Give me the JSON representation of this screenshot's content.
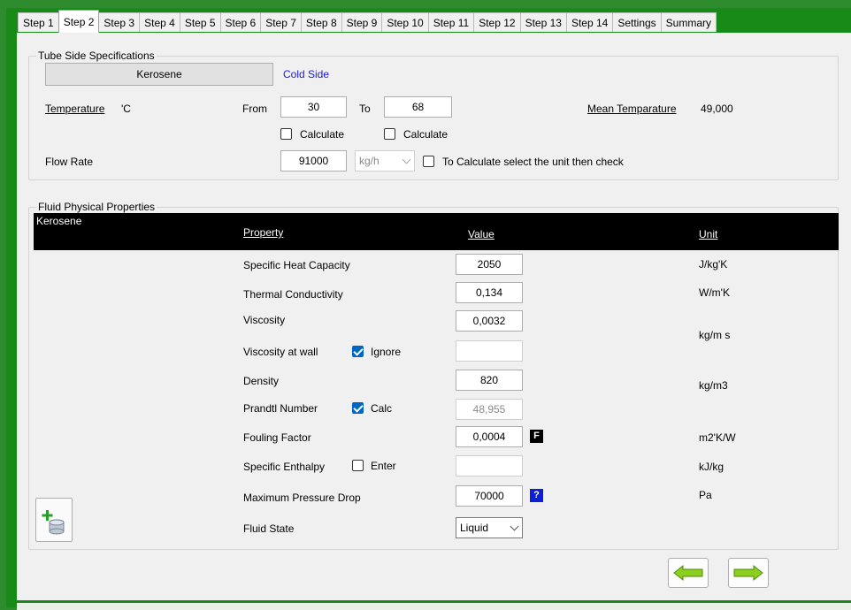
{
  "tabs": [
    "Step 1",
    "Step 2",
    "Step 3",
    "Step 4",
    "Step 5",
    "Step 6",
    "Step 7",
    "Step 8",
    "Step 9",
    "Step 10",
    "Step 11",
    "Step 12",
    "Step 13",
    "Step 14",
    "Settings",
    "Summary"
  ],
  "active_tab": "Step 2",
  "tube_side": {
    "legend": "Tube Side Specifications",
    "fluid_button": "Kerosene",
    "side_label": "Cold Side",
    "temperature_label": "Temperature",
    "temperature_unit": "'C",
    "from_label": "From",
    "from_value": "30",
    "to_label": "To",
    "to_value": "68",
    "calculate_from_label": "Calculate",
    "calculate_to_label": "Calculate",
    "mean_label": "Mean Temparature",
    "mean_value": "49,000",
    "flow_label": "Flow Rate",
    "flow_value": "91000",
    "flow_unit": "kg/h",
    "calc_hint": "To Calculate select the unit then check"
  },
  "fluid_props": {
    "legend": "Fluid Physical Properties",
    "fluid_name": "Kerosene",
    "col_property": "Property",
    "col_value": "Value",
    "col_unit": "Unit",
    "rows": {
      "cp": {
        "label": "Specific Heat Capacity",
        "value": "2050",
        "unit": "J/kg'K"
      },
      "k": {
        "label": "Thermal Conductivity",
        "value": "0,134",
        "unit": "W/m'K"
      },
      "mu": {
        "label": "Viscosity",
        "value": "0,0032",
        "unit": "kg/m s"
      },
      "muw": {
        "label": "Viscosity at wall",
        "check_label": "Ignore",
        "value": ""
      },
      "rho": {
        "label": "Density",
        "value": "820",
        "unit": "kg/m3"
      },
      "pr": {
        "label": "Prandtl Number",
        "check_label": "Calc",
        "value": "48,955"
      },
      "ff": {
        "label": "Fouling Factor",
        "value": "0,0004",
        "unit": "m2'K/W",
        "icon": "F"
      },
      "h": {
        "label": "Specific Enthalpy",
        "check_label": "Enter",
        "value": "",
        "unit": "kJ/kg"
      },
      "dp": {
        "label": "Maximum Pressure Drop",
        "value": "70000",
        "unit": "Pa",
        "icon": "?"
      },
      "state": {
        "label": "Fluid State",
        "value": "Liquid"
      }
    }
  },
  "colors": {
    "accent_green": "#178a17",
    "nav_arrow": "#8ccf1e",
    "help_blue": "#0a1fd6",
    "checkbox_blue": "#0067c0"
  }
}
